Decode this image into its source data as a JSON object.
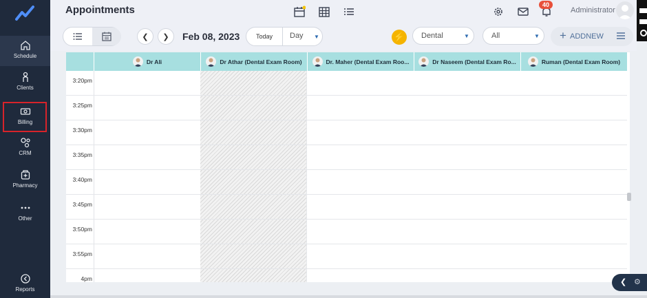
{
  "header": {
    "title": "Appointments",
    "notification_count": "40",
    "user_name": "Administrator"
  },
  "sidebar": {
    "items": [
      {
        "label": "Schedule",
        "icon": "home-icon"
      },
      {
        "label": "Clients",
        "icon": "person-icon"
      },
      {
        "label": "Billing",
        "icon": "money-icon"
      },
      {
        "label": "CRM",
        "icon": "crm-icon"
      },
      {
        "label": "Pharmacy",
        "icon": "pharmacy-icon"
      },
      {
        "label": "Other",
        "icon": "more-icon"
      },
      {
        "label": "Reports",
        "icon": "reports-icon"
      }
    ]
  },
  "toolbar": {
    "date": "Feb 08, 2023",
    "today_label": "Today",
    "view_label": "Day",
    "department": "Dental",
    "filter": "All",
    "add_label": "ADDNEW"
  },
  "calendar": {
    "columns": [
      "Dr Ali",
      "Dr Athar (Dental Exam Room)",
      "Dr. Maher (Dental Exam Roo...",
      "Dr Naseem (Dental Exam Ro...",
      "Ruman (Dental Exam Room)"
    ],
    "times": [
      "3:20pm",
      "3:25pm",
      "3:30pm",
      "3:35pm",
      "3:40pm",
      "3:45pm",
      "3:50pm",
      "3:55pm",
      "4pm"
    ]
  },
  "colors": {
    "sidebar": "#1f2a3c",
    "header_band": "#a7dfe0",
    "highlight": "#d8232a",
    "accent": "#f5b400"
  }
}
